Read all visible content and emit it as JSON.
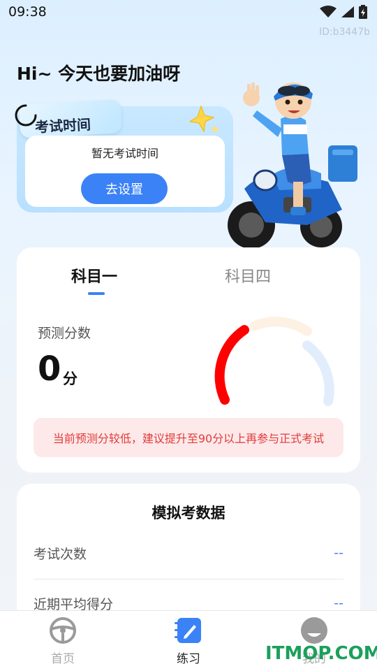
{
  "status_bar": {
    "time": "09:38"
  },
  "user_id": "ID:b3447b",
  "greeting": "Hi~ 今天也要加油呀",
  "exam_card": {
    "title": "考试时间",
    "empty_text": "暂无考试时间",
    "set_button": "去设置"
  },
  "score_card": {
    "tabs": [
      "科目一",
      "科目四"
    ],
    "active_tab": 0,
    "predict_label": "预测分数",
    "score_value": "0",
    "score_unit": "分",
    "gauge_fraction": 0.0,
    "warning": "当前预测分较低，建议提升至90分以上再参与正式考试"
  },
  "sim_card": {
    "title": "模拟考数据",
    "rows": [
      {
        "label": "考试次数",
        "value": "--"
      },
      {
        "label": "近期平均得分",
        "value": "--"
      }
    ]
  },
  "tabbar": {
    "items": [
      {
        "label": "首页",
        "icon": "steering-wheel-icon",
        "active": false
      },
      {
        "label": "练习",
        "icon": "notebook-pen-icon",
        "active": true
      },
      {
        "label": "我的",
        "icon": "profile-icon",
        "active": false
      }
    ]
  },
  "watermark": "ITMOP.COM",
  "colors": {
    "accent": "#3b82f6",
    "warning": "#e23a3a",
    "gauge_red": "#ff0000",
    "watermark": "#1aa05a"
  }
}
